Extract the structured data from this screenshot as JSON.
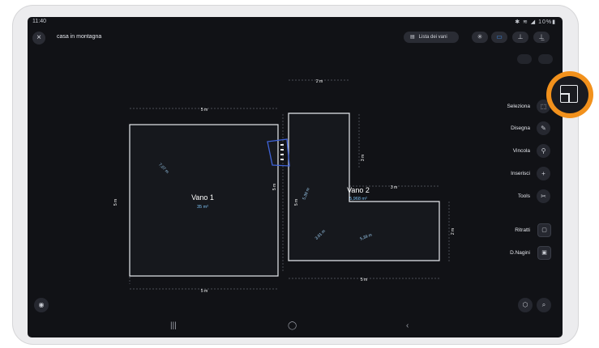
{
  "status": {
    "time": "11:40",
    "icons": "✱ ≋ ◢ 10%▮"
  },
  "header": {
    "close_icon": "×",
    "project_title": "casa in montagna",
    "rooms_button_icon": "▤",
    "rooms_button_label": "Lista dei vani",
    "icons": [
      "✳",
      "▭",
      "⊥",
      "⊥̲"
    ]
  },
  "floorplan": {
    "room1": {
      "name": "Vano 1",
      "area": "35 m²",
      "diagonal": "7,07 m",
      "dim_top": "5 m",
      "dim_left": "5 m",
      "dim_bottom": "5 m",
      "dim_right": "5 m"
    },
    "room2": {
      "name": "Vano 2",
      "area": "5,968 m²",
      "dim_top": "2 m",
      "dim_step_top": "3 m",
      "dim_left": "5 m",
      "dim_inner": "3 m",
      "dim_right": "2 m",
      "dim_bottom": "5 m",
      "diag_a": "5,39 m",
      "diag_b": "3,61 m",
      "diag_c": "5,39 m"
    }
  },
  "tools": [
    {
      "label": "Seleziona",
      "icon": "⬚"
    },
    {
      "label": "Disegna",
      "icon": "✎"
    },
    {
      "label": "Vincola",
      "icon": "⚲"
    },
    {
      "label": "Inserisci",
      "icon": "+"
    },
    {
      "label": "Tools",
      "icon": "✂"
    }
  ],
  "side_actions": [
    {
      "label": "Ritratti",
      "icon": "▢"
    },
    {
      "label": "D.Nagini",
      "icon": "▣"
    }
  ],
  "bottom": {
    "left_icon": "◉",
    "right_icons": [
      "⬡",
      "⌕"
    ]
  },
  "nav": {
    "recents": "|||",
    "home": "◯",
    "back": "‹"
  },
  "accent": "#3d8ff0",
  "highlight_color": "#f2911c"
}
